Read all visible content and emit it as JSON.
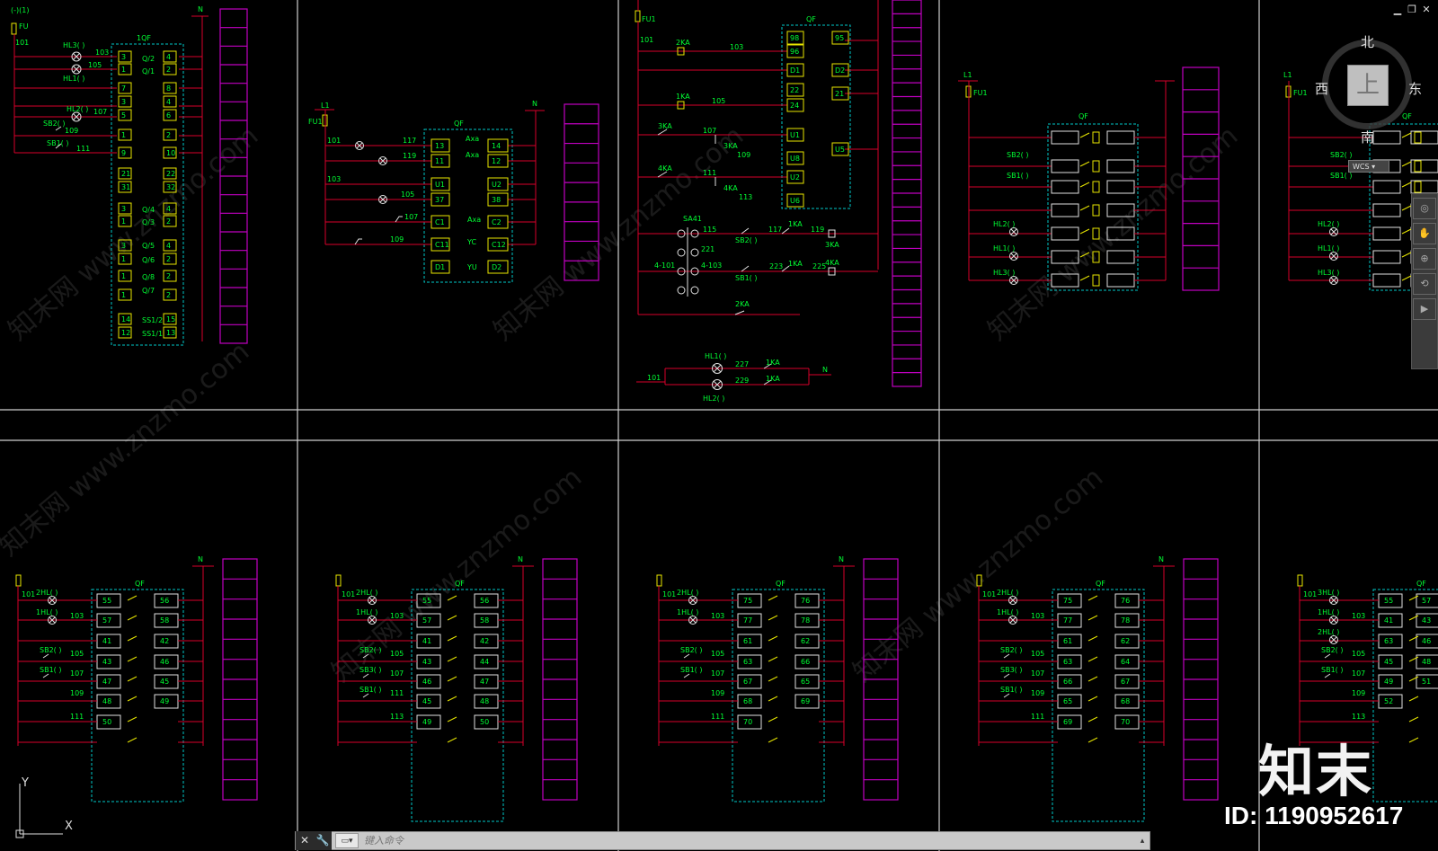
{
  "window": {
    "min": "▁",
    "restore": "❐",
    "close": "✕"
  },
  "viewcube": {
    "north": "北",
    "south": "南",
    "east": "东",
    "west": "西",
    "face": "上",
    "wcs": "WCS ▾"
  },
  "commandline": {
    "placeholder": "键入命令",
    "close": "✕",
    "customize": "🔧",
    "prompt": "▭▾",
    "history": "▴"
  },
  "watermark": "知末网 www.znzmo.com",
  "brand": {
    "logo": "知末",
    "id": "ID: 1190952617"
  },
  "ucs": {
    "y": "Y",
    "x": "X"
  },
  "panel1": {
    "fuse": "FU",
    "top": "(-)(1)",
    "n": "N",
    "qf": "1QF",
    "wires": [
      "101",
      "103",
      "105",
      "107",
      "109",
      "111"
    ],
    "lamps": [
      "HL3(  )",
      "HL1(  )",
      "HL2(  )"
    ],
    "switches": [
      "SB2(  )",
      "SB1(  )"
    ],
    "terms": [
      "3",
      "4",
      "1",
      "2",
      "7",
      "8",
      "3",
      "4",
      "5",
      "6",
      "1",
      "2",
      "9",
      "10",
      "21",
      "22",
      "31",
      "32",
      "3",
      "4",
      "1",
      "2",
      "3",
      "4",
      "1",
      "2",
      "1",
      "2",
      "1",
      "2",
      "14",
      "15",
      "12",
      "13"
    ],
    "subs": [
      "Q/2",
      "Q/1",
      "Q/4",
      "Q/3",
      "Q/5",
      "Q/6",
      "Q/8",
      "Q/7",
      "SS1/2",
      "SS1/1"
    ]
  },
  "panel2": {
    "l1": "L1",
    "fu": "FU1",
    "n": "N",
    "qf": "QF",
    "wires": [
      "101",
      "117",
      "119",
      "103",
      "105",
      "107",
      "109"
    ],
    "terms": [
      "13",
      "14",
      "11",
      "12",
      "U1",
      "U2",
      "37",
      "38",
      "C1",
      "C2",
      "C11",
      "C12",
      "D1",
      "D2"
    ],
    "aux": [
      "Axa",
      "Axa",
      "Axa",
      "YC",
      "YU"
    ]
  },
  "panel3": {
    "fu": "FU1",
    "qf": "QF",
    "wires": [
      "101",
      "103",
      "105",
      "107",
      "109",
      "111",
      "113",
      "115",
      "117",
      "119",
      "221",
      "223",
      "225",
      "227",
      "229"
    ],
    "relays": [
      "2KA",
      "1KA",
      "3KA",
      "4KA",
      "3KA",
      "4KA",
      "1KA",
      "1KA",
      "2KA",
      "3KA",
      "4KA"
    ],
    "sa": "SA41",
    "sapos": [
      "4-101",
      "4-103"
    ],
    "switches": [
      "SB2(  )",
      "SB1(  )"
    ],
    "terms": [
      "98",
      "95",
      "96",
      "D1",
      "D2",
      "22",
      "21",
      "24",
      "U1",
      "U5",
      "U8",
      "U2",
      "U6"
    ],
    "lamps": [
      "HL1(  )",
      "HL2(  )"
    ],
    "n": "N"
  },
  "panel4": {
    "l1": "L1",
    "fu": "FU1",
    "qf": "QF",
    "switches": [
      "SB2(  )",
      "SB1(  )"
    ],
    "lamps": [
      "HL2(  )",
      "HL1(  )",
      "HL3(  )"
    ]
  },
  "panel5": {
    "l1": "L1",
    "fu": "FU1",
    "qf": "QF",
    "switches": [
      "SB2(  )",
      "SB1(  )"
    ],
    "lamps": [
      "HL2(  )",
      "HL1(  )",
      "HL3(  )"
    ]
  },
  "bottom_panels": [
    {
      "n": "N",
      "qf": "QF",
      "wires": [
        "101",
        "103",
        "105",
        "107",
        "109",
        "111"
      ],
      "lamps": [
        "2HL(  )",
        "1HL(  )"
      ],
      "switches": [
        "SB2(  )",
        "SB1(  )"
      ],
      "terms": [
        "55",
        "56",
        "57",
        "58",
        "41",
        "42",
        "43",
        "46",
        "47",
        "45",
        "48",
        "49",
        "50"
      ]
    },
    {
      "n": "N",
      "qf": "QF",
      "wires": [
        "101",
        "103",
        "105",
        "107",
        "111",
        "113"
      ],
      "lamps": [
        "2HL(  )",
        "1HL(  )"
      ],
      "switches": [
        "SB2(  )",
        "SB3(  )",
        "SB1(  )"
      ],
      "terms": [
        "55",
        "56",
        "57",
        "58",
        "41",
        "42",
        "43",
        "44",
        "46",
        "47",
        "45",
        "48",
        "49",
        "50"
      ]
    },
    {
      "n": "N",
      "qf": "QF",
      "wires": [
        "101",
        "103",
        "105",
        "107",
        "109",
        "111"
      ],
      "lamps": [
        "2HL(  )",
        "1HL(  )"
      ],
      "switches": [
        "SB2(  )",
        "SB1(  )"
      ],
      "terms": [
        "75",
        "76",
        "77",
        "78",
        "61",
        "62",
        "63",
        "66",
        "67",
        "65",
        "68",
        "69",
        "70"
      ]
    },
    {
      "n": "N",
      "qf": "QF",
      "wires": [
        "101",
        "103",
        "105",
        "107",
        "109",
        "111"
      ],
      "lamps": [
        "2HL(  )",
        "1HL(  )"
      ],
      "switches": [
        "SB2(  )",
        "SB3(  )",
        "SB1(  )"
      ],
      "terms": [
        "75",
        "76",
        "77",
        "78",
        "61",
        "62",
        "63",
        "64",
        "66",
        "67",
        "65",
        "68",
        "69",
        "70"
      ]
    },
    {
      "n": "N",
      "qf": "QF",
      "wires": [
        "101",
        "103",
        "105",
        "107",
        "109",
        "113"
      ],
      "lamps": [
        "3HL(  )",
        "1HL(  )",
        "2HL(  )"
      ],
      "switches": [
        "SB2(  )",
        "SB1(  )"
      ],
      "terms": [
        "55",
        "57",
        "41",
        "43",
        "63",
        "46",
        "45",
        "48",
        "49",
        "51",
        "52"
      ]
    }
  ]
}
